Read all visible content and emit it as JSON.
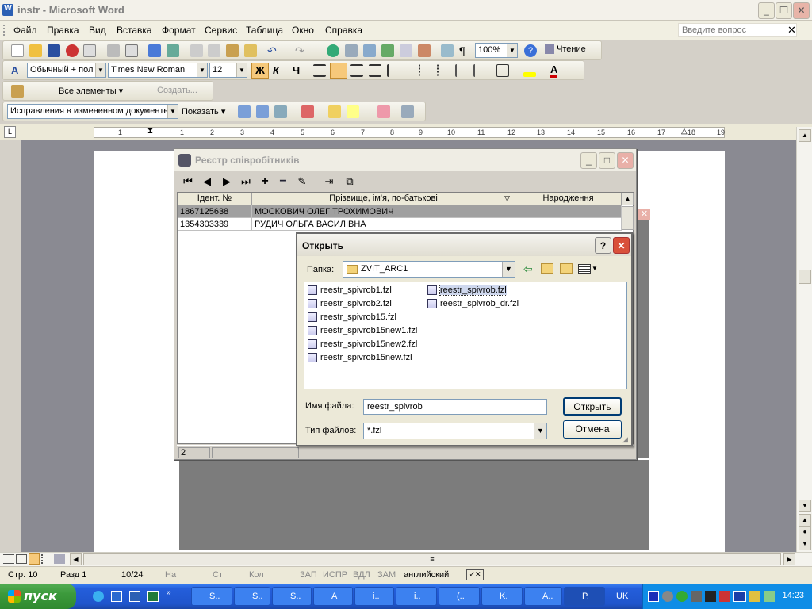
{
  "word": {
    "title": "instr - Microsoft Word",
    "menu": [
      "Файл",
      "Правка",
      "Вид",
      "Вставка",
      "Формат",
      "Сервис",
      "Таблица",
      "Окно",
      "Справка"
    ],
    "ask_placeholder": "Введите вопрос",
    "zoom": "100%",
    "reading_label": "Чтение",
    "style_value": "Обычный + пол",
    "font_value": "Times New Roman",
    "size_value": "12",
    "bold_label": "Ж",
    "italic_label": "К",
    "underline_label": "Ч",
    "all_elements_label": "Все элементы",
    "create_label": "Создать...",
    "track_changes_value": "Исправления в измененном документе",
    "show_label": "Показать",
    "ruler_numbers": [
      "1",
      "1",
      "2",
      "3",
      "4",
      "5",
      "6",
      "7",
      "8",
      "9",
      "10",
      "11",
      "12",
      "13",
      "14",
      "15",
      "16",
      "17",
      "18",
      "19"
    ]
  },
  "status": {
    "page": "Стр. 10",
    "section": "Разд 1",
    "pages": "10/24",
    "at": "На",
    "line": "Ст",
    "col": "Кол",
    "rec": "ЗАП",
    "trk": "ИСПР",
    "ext": "ВДЛ",
    "ovr": "ЗАМ",
    "language": "английский"
  },
  "app": {
    "title": "Реєстр співробітників",
    "columns": [
      "Ідент. №",
      "Прізвище, ім'я, по-батькові",
      "Народження"
    ],
    "rows": [
      {
        "id": "1867125638",
        "name": "МОСКОВИЧ ОЛЕГ ТРОХИМОВИЧ",
        "birth": ""
      },
      {
        "id": "1354303339",
        "name": "РУДИЧ ОЛЬГА ВАСИЛІВНА",
        "birth": ""
      }
    ],
    "status_count": "2"
  },
  "dialog": {
    "title": "Открыть",
    "folder_label": "Папка:",
    "folder_value": "ZVIT_ARC1",
    "files_col1": [
      "reestr_spivrob1.fzl",
      "reestr_spivrob2.fzl",
      "reestr_spivrob15.fzl",
      "reestr_spivrob15new1.fzl",
      "reestr_spivrob15new2.fzl",
      "reestr_spivrob15new.fzl"
    ],
    "files_col2": [
      "reestr_spivrob.fzl",
      "reestr_spivrob_dr.fzl"
    ],
    "filename_label": "Имя файла:",
    "filename_value": "reestr_spivrob",
    "filetype_label": "Тип файлов:",
    "filetype_value": "*.fzl",
    "open_button": "Открыть",
    "cancel_button": "Отмена"
  },
  "taskbar": {
    "start_label": "пуск",
    "tasks": [
      "S..",
      "S..",
      "S..",
      "A",
      "i..",
      "i..",
      "(..",
      "K.",
      "A..",
      "P."
    ],
    "lang": "UK",
    "clock": "14:23"
  }
}
